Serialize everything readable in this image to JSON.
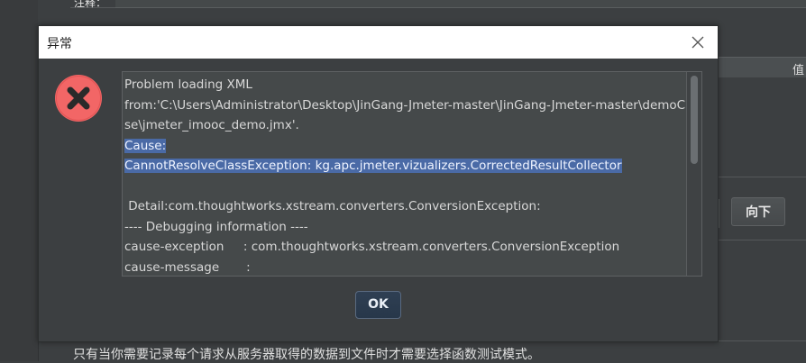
{
  "background": {
    "top_label": "注释：",
    "table_header_right": "值",
    "down_button_label": "向下",
    "bottom_hint": "只有当你需要记录每个请求从服务器取得的数据到文件时才需要选择函数测试模式。"
  },
  "dialog": {
    "title": "异常",
    "message_lines": [
      "Problem loading XML",
      "from:'C:\\Users\\Administrator\\Desktop\\JinGang-Jmeter-master\\JinGang-Jmeter-master\\demoCa",
      "se\\jmeter_imooc_demo.jmx'.",
      "Cause:",
      "CannotResolveClassException: kg.apc.jmeter.vizualizers.CorrectedResultCollector",
      "",
      " Detail:com.thoughtworks.xstream.converters.ConversionException:",
      "---- Debugging information ----",
      "cause-exception     : com.thoughtworks.xstream.converters.ConversionException",
      "cause-message       :"
    ],
    "ok_label": "OK"
  },
  "colors": {
    "error_icon": "#f26666",
    "selection": "#4a6aa6"
  },
  "icons": {
    "close": "close-icon",
    "error": "error-icon"
  }
}
